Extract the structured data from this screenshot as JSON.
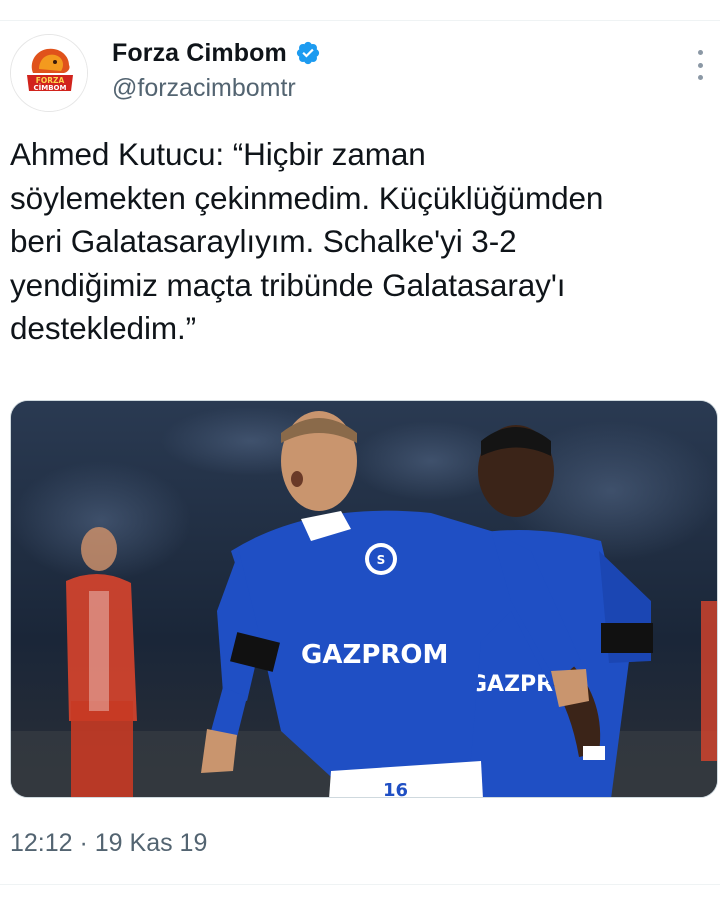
{
  "tweet": {
    "author": {
      "display_name": "Forza Cimbom",
      "handle": "@forzacimbomtr",
      "verified": true,
      "avatar_text_line1": "FORZA",
      "avatar_text_line2": "CİMBOM"
    },
    "text": "Ahmed Kutucu: “Hiçbir zaman\nsöylemekten çekinmedim. Küçüklüğümden\nberi Galatasaraylıyım. Schalke'yi 3-2\nyendiğimiz maçta tribünde Galatasaray'ı\ndestekledim.”",
    "media": {
      "sponsor_label": "GAZPROM",
      "sponsor_label_2": "GAZPRO",
      "shorts_number": "16"
    },
    "timestamp": "12:12 · 19 Kas 19"
  },
  "colors": {
    "text_primary": "#0f1419",
    "text_secondary": "#536471",
    "verified_blue": "#1d9bf0",
    "schalke_blue": "#1f4fc4",
    "brand_red": "#d1231c"
  },
  "icons": {
    "verified": "verified-badge-icon",
    "more": "more-options-icon"
  }
}
